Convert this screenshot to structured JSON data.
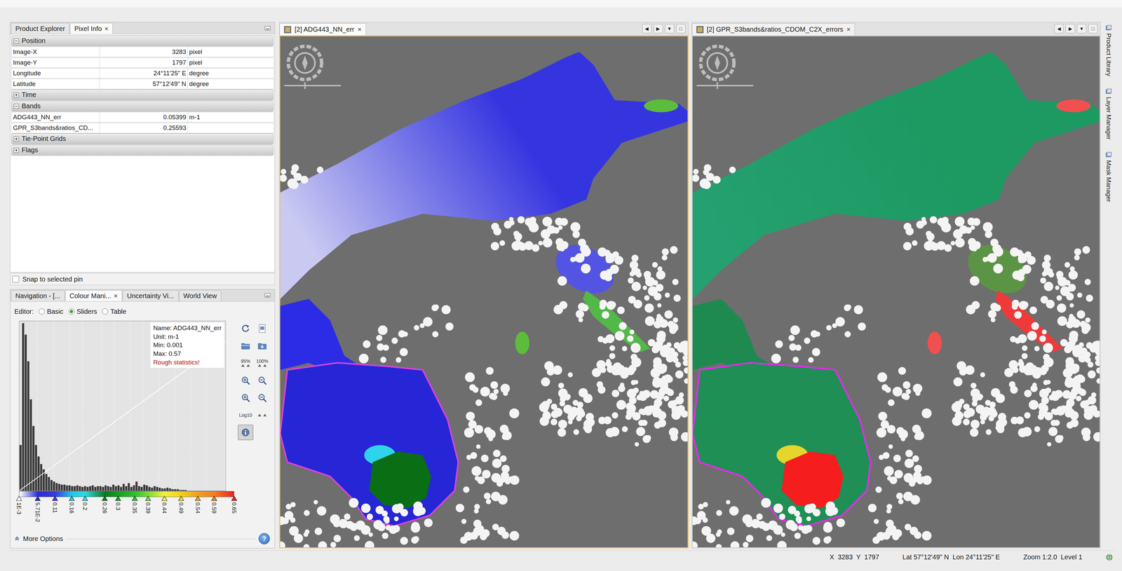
{
  "pixel_info_panel": {
    "tabs": [
      {
        "label": "Product Explorer",
        "selected": false,
        "close": ""
      },
      {
        "label": "Pixel Info",
        "selected": true,
        "close": "×"
      }
    ],
    "sections": [
      {
        "title": "Position",
        "expanded": true,
        "rows": [
          {
            "name": "Image-X",
            "value": "3283",
            "unit": "pixel"
          },
          {
            "name": "Image-Y",
            "value": "1797",
            "unit": "pixel"
          },
          {
            "name": "Longitude",
            "value": "24°11'25\" E",
            "unit": "degree"
          },
          {
            "name": "Latitude",
            "value": "57°12'49\" N",
            "unit": "degree"
          }
        ]
      },
      {
        "title": "Time",
        "expanded": false,
        "rows": []
      },
      {
        "title": "Bands",
        "expanded": true,
        "rows": [
          {
            "name": "ADG443_NN_err",
            "value": "0.05399",
            "unit": "m-1"
          },
          {
            "name": "GPR_S3bands&ratios_CD...",
            "value": "0.25593",
            "unit": ""
          }
        ]
      },
      {
        "title": "Tie-Point Grids",
        "expanded": false,
        "rows": []
      },
      {
        "title": "Flags",
        "expanded": false,
        "rows": []
      }
    ],
    "snap": {
      "label": "Snap to selected pin",
      "checked": false
    }
  },
  "colour_panel": {
    "tabs": [
      {
        "label": "Navigation - [...",
        "selected": false,
        "close": ""
      },
      {
        "label": "Colour Mani...",
        "selected": true,
        "close": "×"
      },
      {
        "label": "Uncertainty Vi...",
        "selected": false,
        "close": ""
      },
      {
        "label": "World View",
        "selected": false,
        "close": ""
      }
    ],
    "editor": {
      "label": "Editor:",
      "options": [
        {
          "label": "Basic",
          "selected": false
        },
        {
          "label": "Sliders",
          "selected": true
        },
        {
          "label": "Table",
          "selected": false
        }
      ]
    },
    "histogram": {
      "info": [
        "Name: ADG443_NN_err",
        "Unit: m-1",
        "Min: 0.001",
        "Max: 0.57"
      ],
      "warning": "Rough statistics!",
      "counts": [
        60,
        220,
        205,
        170,
        120,
        85,
        60,
        45,
        35,
        28,
        22,
        18,
        14,
        12,
        10,
        9,
        8,
        8,
        7,
        7,
        6,
        6,
        7,
        6,
        5,
        6,
        5,
        6,
        7,
        5,
        6,
        6,
        5,
        7,
        6,
        5,
        8,
        6,
        7,
        5,
        9,
        6,
        10,
        5,
        7,
        12,
        6,
        5,
        8,
        7,
        5,
        4,
        6,
        5,
        4,
        3,
        3,
        4,
        3,
        2,
        2,
        2,
        1,
        1,
        1,
        0,
        0,
        0,
        0,
        0,
        0,
        0,
        0,
        0,
        0,
        0,
        0,
        0,
        0,
        0
      ]
    },
    "sliders": [
      {
        "label": "1E-3",
        "color": "#ffffff"
      },
      {
        "label": "5.71E-2",
        "color": "#2b2bd6"
      },
      {
        "label": "0.11",
        "color": "#3a3ae0"
      },
      {
        "label": "0.16",
        "color": "#20c8e8"
      },
      {
        "label": "0.2",
        "color": "#30d8e0"
      },
      {
        "label": "0.26",
        "color": "#0a7a20"
      },
      {
        "label": "0.3",
        "color": "#12a020"
      },
      {
        "label": "0.35",
        "color": "#2cc22c"
      },
      {
        "label": "0.39",
        "color": "#7ad83a"
      },
      {
        "label": "0.44",
        "color": "#f2f040"
      },
      {
        "label": "0.49",
        "color": "#f0d020"
      },
      {
        "label": "0.54",
        "color": "#f0a020"
      },
      {
        "label": "0.59",
        "color": "#f08020"
      },
      {
        "label": "0.65",
        "color": "#f02020"
      }
    ],
    "tools": [
      {
        "kind": "reset",
        "label": "",
        "selected": false
      },
      {
        "kind": "import",
        "label": "",
        "selected": false
      },
      {
        "kind": "open",
        "label": "",
        "selected": false
      },
      {
        "kind": "save",
        "label": "",
        "selected": false
      },
      {
        "kind": "percent",
        "label": "95%",
        "selected": false
      },
      {
        "kind": "percent",
        "label": "100%",
        "selected": false
      },
      {
        "kind": "zoom-in",
        "label": "",
        "selected": false
      },
      {
        "kind": "zoom-out",
        "label": "",
        "selected": false
      },
      {
        "kind": "zoom-in",
        "label": "",
        "selected": false
      },
      {
        "kind": "zoom-out",
        "label": "",
        "selected": false
      },
      {
        "kind": "log",
        "label": "Log10",
        "selected": false
      },
      {
        "kind": "distribute",
        "label": "",
        "selected": false
      },
      {
        "kind": "info",
        "label": "",
        "selected": true
      }
    ],
    "more_options": "More Options",
    "help": "?"
  },
  "views": [
    {
      "title": "[2] ADG443_NN_err",
      "selected": true,
      "close": "×",
      "kind": "adg"
    },
    {
      "title": "[2] GPR_S3bands&ratios_CDOM_C2X_errors",
      "selected": false,
      "close": "×",
      "kind": "gpr"
    }
  ],
  "view_controls": [
    "◀",
    "▶",
    "▼",
    "□"
  ],
  "side_tabs": [
    "Product Library",
    "Layer Manager",
    "Mask Manager"
  ],
  "status_bar": [
    "X  3283  Y  1797",
    "Lat 57°12'49\" N  Lon 24°11'25\" E",
    "Zoom 1:2.0  Level 1"
  ]
}
